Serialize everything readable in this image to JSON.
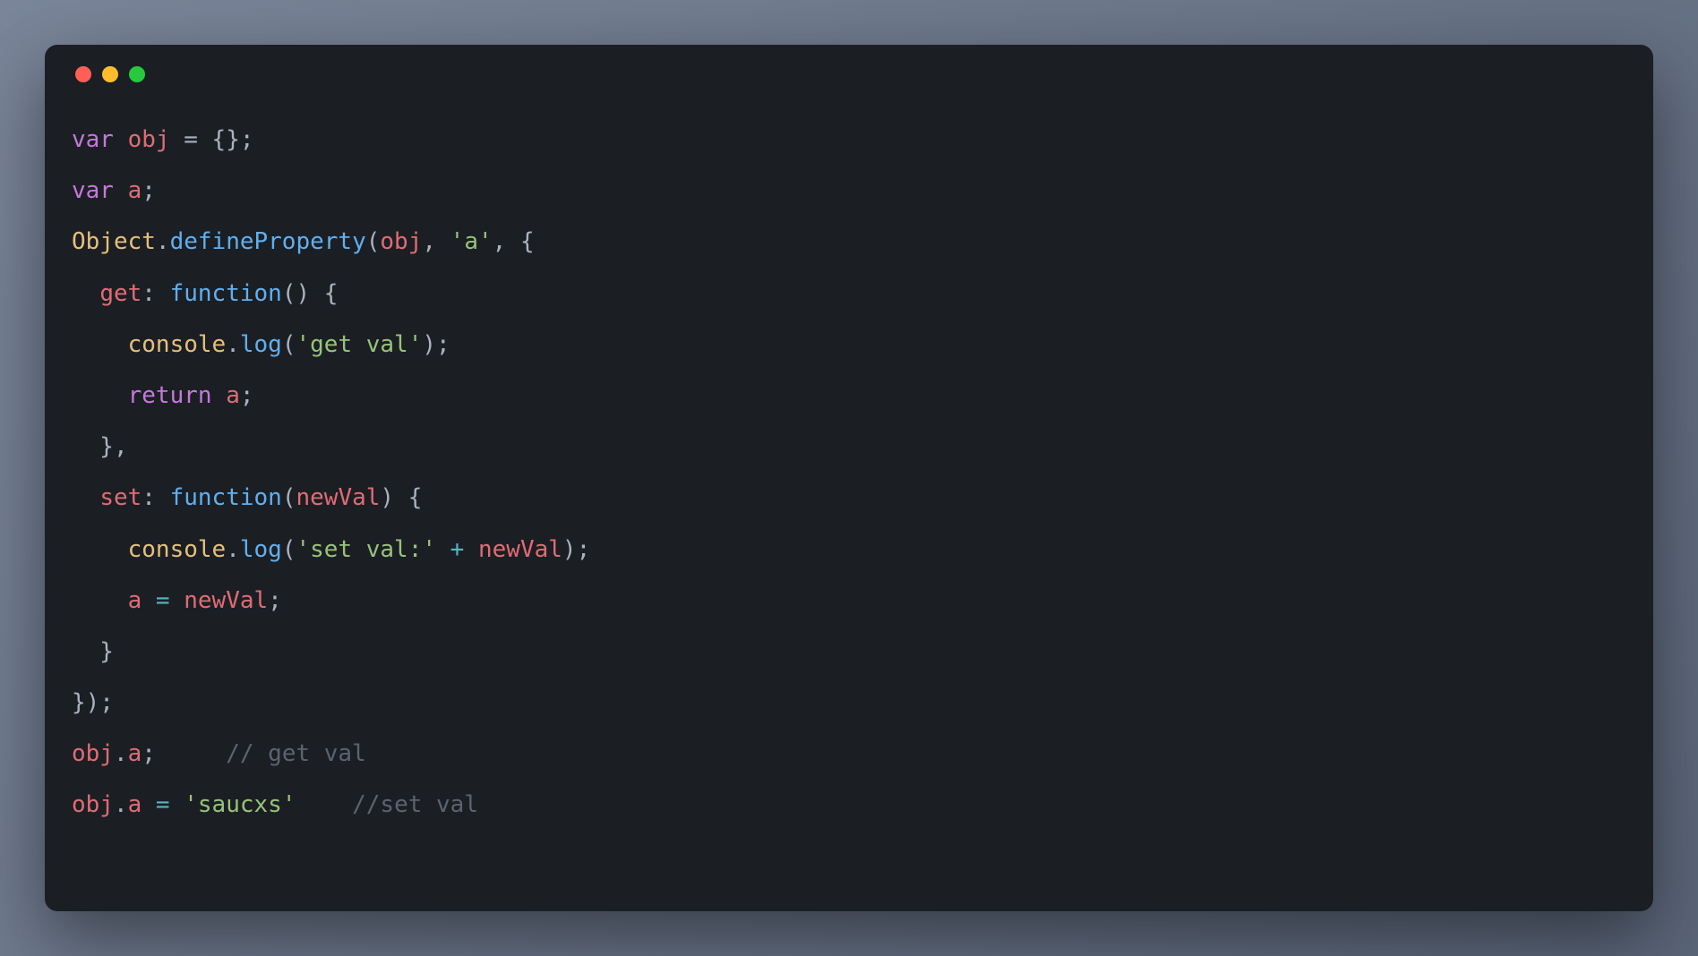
{
  "traffic_lights": {
    "red": "#ff5f56",
    "yellow": "#ffbd2e",
    "green": "#27c93f"
  },
  "code": {
    "l1": {
      "kw": "var",
      "ident": "obj",
      "tail": " = {};"
    },
    "l2": {
      "kw": "var",
      "ident": "a",
      "tail": ";"
    },
    "l3": {
      "cls": "Object",
      "dot": ".",
      "fn": "defineProperty",
      "open": "(",
      "arg1": "obj",
      "comma1": ", ",
      "str": "'a'",
      "comma2": ", {"
    },
    "l4": {
      "indent": "  ",
      "key": "get",
      "colon": ": ",
      "fnkw": "function",
      "paren": "() {"
    },
    "l5": {
      "indent": "    ",
      "cls": "console",
      "dot": ".",
      "fn": "log",
      "open": "(",
      "str": "'get val'",
      "close": ");　"
    },
    "l6": {
      "indent": "    ",
      "kw": "return",
      "sp": " ",
      "ident": "a",
      "tail": ";"
    },
    "l7": {
      "text": "  },"
    },
    "l8": {
      "indent": "  ",
      "key": "set",
      "colon": ": ",
      "fnkw": "function",
      "open": "(",
      "param": "newVal",
      "close": ") {"
    },
    "l9": {
      "indent": "    ",
      "cls": "console",
      "dot": ".",
      "fn": "log",
      "open": "(",
      "str": "'set val:'",
      "plus": " + ",
      "ident": "newVal",
      "close": ");"
    },
    "l10": {
      "indent": "    ",
      "ident1": "a",
      "eq": " = ",
      "ident2": "newVal",
      "tail": ";"
    },
    "l11": {
      "text": "  }"
    },
    "l12": {
      "text": "});"
    },
    "l13": {
      "ident": "obj",
      "dot": ".",
      "prop": "a",
      "tail": ";     ",
      "comment": "// get val"
    },
    "l14": {
      "ident": "obj",
      "dot": ".",
      "prop": "a",
      "eq": " = ",
      "str": "'saucxs'",
      "sp": "    ",
      "comment": "//set val"
    }
  }
}
